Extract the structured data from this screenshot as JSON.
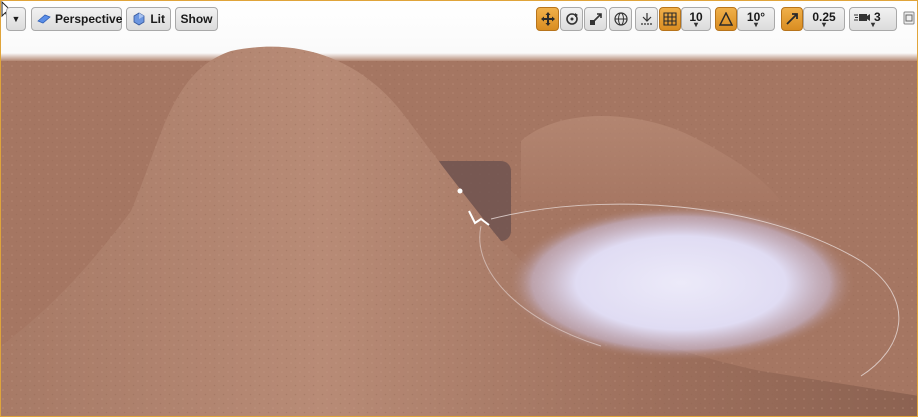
{
  "toolbar": {
    "view_mode_label": "Perspective",
    "lighting_label": "Lit",
    "show_label": "Show",
    "grid_snap_value": "10",
    "rotation_snap_value": "10°",
    "scale_snap_value": "0.25",
    "camera_speed_value": "3"
  },
  "colors": {
    "accent": "#e0a43a",
    "ground": "#a87864",
    "light_spot": "#e4e2f6"
  },
  "icons": [
    "dropdown-arrow-icon",
    "perspective-cube-icon",
    "lit-sphere-icon",
    "translate-icon",
    "rotate-icon",
    "scale-icon",
    "world-space-icon",
    "surface-snap-icon",
    "grid-snap-icon",
    "rotation-snap-icon",
    "scale-snap-icon",
    "camera-speed-icon",
    "maximize-icon"
  ]
}
